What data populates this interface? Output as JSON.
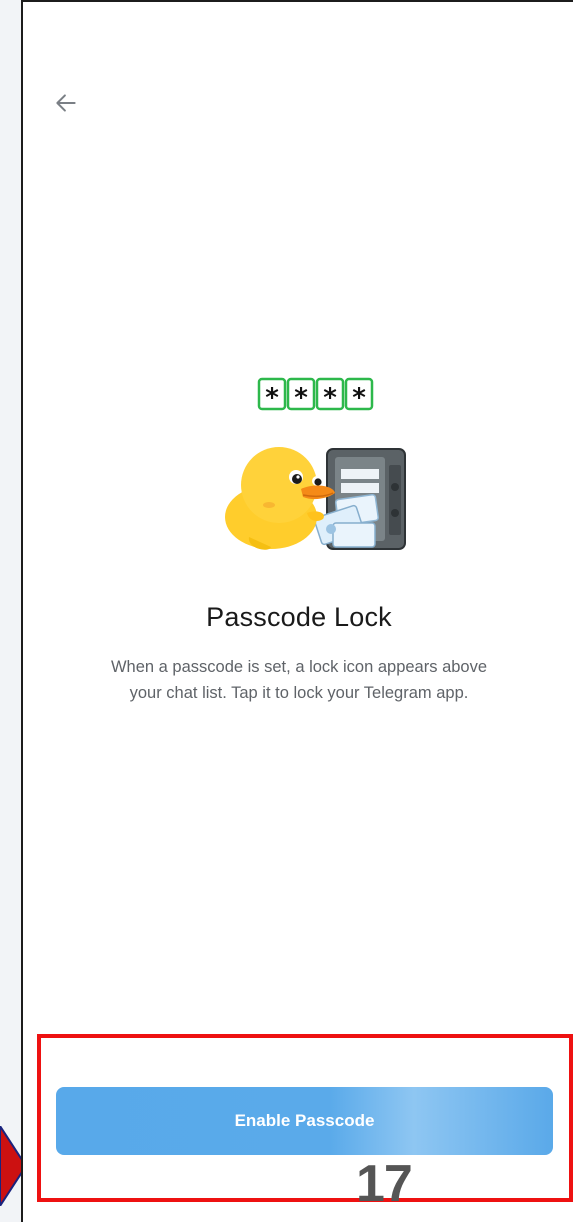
{
  "screen": {
    "back_icon": "arrow-left-icon",
    "illustration_icon": "duck-safe-sticker-icon",
    "passcode_chars": [
      "*",
      "*",
      "*",
      "*"
    ],
    "title": "Passcode Lock",
    "description": "When a passcode is set, a lock icon appears above your chat list. Tap it to lock your Telegram app.",
    "button_label": "Enable Passcode"
  },
  "annotation": {
    "step_number": "17",
    "highlight_color": "#ee1111",
    "pointer_color": "#cc1111"
  },
  "colors": {
    "accent": "#5aaaea",
    "title": "#1a1a1a",
    "description": "#5f6368",
    "passcode_border": "#2db84b"
  }
}
